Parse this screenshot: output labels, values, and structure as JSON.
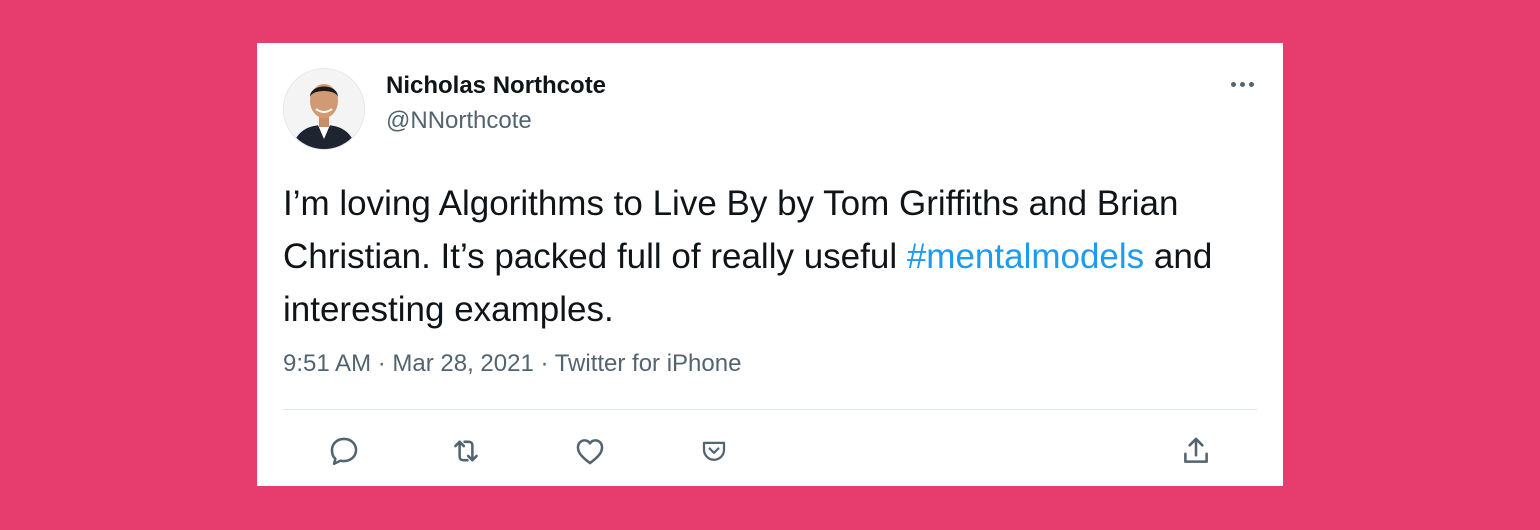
{
  "tweet": {
    "author": {
      "name": "Nicholas Northcote",
      "handle": "@NNorthcote"
    },
    "text_before": "I’m loving Algorithms to Live By by Tom Griffiths and Brian Christian. It’s packed full of really useful ",
    "hashtag": "#mentalmodels",
    "text_after": " and interesting examples.",
    "timestamp": "9:51 AM · Mar 28, 2021 · Twitter for iPhone"
  },
  "actions": {
    "reply_icon": "speech-bubble-icon",
    "retweet_icon": "retweet-icon",
    "like_icon": "heart-icon",
    "save_icon": "pocket-save-icon",
    "share_icon": "share-upload-icon"
  },
  "colors": {
    "background": "#E73D6E",
    "card": "#FFFFFF",
    "text": "#0F1419",
    "secondary_text": "#536471",
    "hashtag": "#1D9BF0",
    "divider": "#E1E8ED"
  }
}
